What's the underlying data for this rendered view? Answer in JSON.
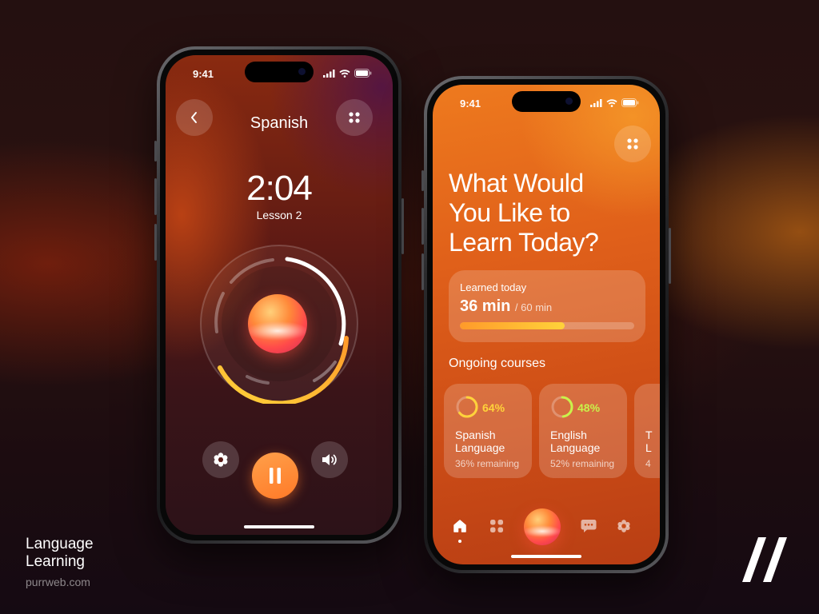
{
  "status_bar": {
    "time": "9:41"
  },
  "player": {
    "title": "Spanish",
    "timer": "2:04",
    "lesson": "Lesson 2"
  },
  "home": {
    "headline": [
      "What Would",
      "You Like to",
      "Learn Today?"
    ],
    "learned": {
      "label": "Learned today",
      "value": "36 min",
      "goal": "/ 60 min",
      "progress_fraction": 0.6
    },
    "section_title": "Ongoing courses",
    "courses": [
      {
        "percent": "64%",
        "name": "Spanish Language",
        "remaining": "36% remaining",
        "progress_fraction": 0.64,
        "color": "#ffd23a"
      },
      {
        "percent": "48%",
        "name": "English Language",
        "remaining": "52% remaining",
        "progress_fraction": 0.48,
        "color": "#c9f24a"
      },
      {
        "percent": "",
        "name": "T\nL",
        "remaining": "4",
        "progress_fraction": 0.0,
        "color": "#ffd23a"
      }
    ]
  },
  "branding": {
    "line1": "Language",
    "line2": "Learning",
    "site": "purrweb.com"
  },
  "colors": {
    "accent_orange": "#ff8a2a",
    "accent_yellow": "#ffd23a",
    "accent_green": "#c9f24a"
  },
  "icons": [
    "back-chevron-icon",
    "grid-icon",
    "settings-icon",
    "pause-icon",
    "volume-icon",
    "home-icon",
    "chat-icon",
    "signal-icon",
    "wifi-icon",
    "battery-icon"
  ]
}
